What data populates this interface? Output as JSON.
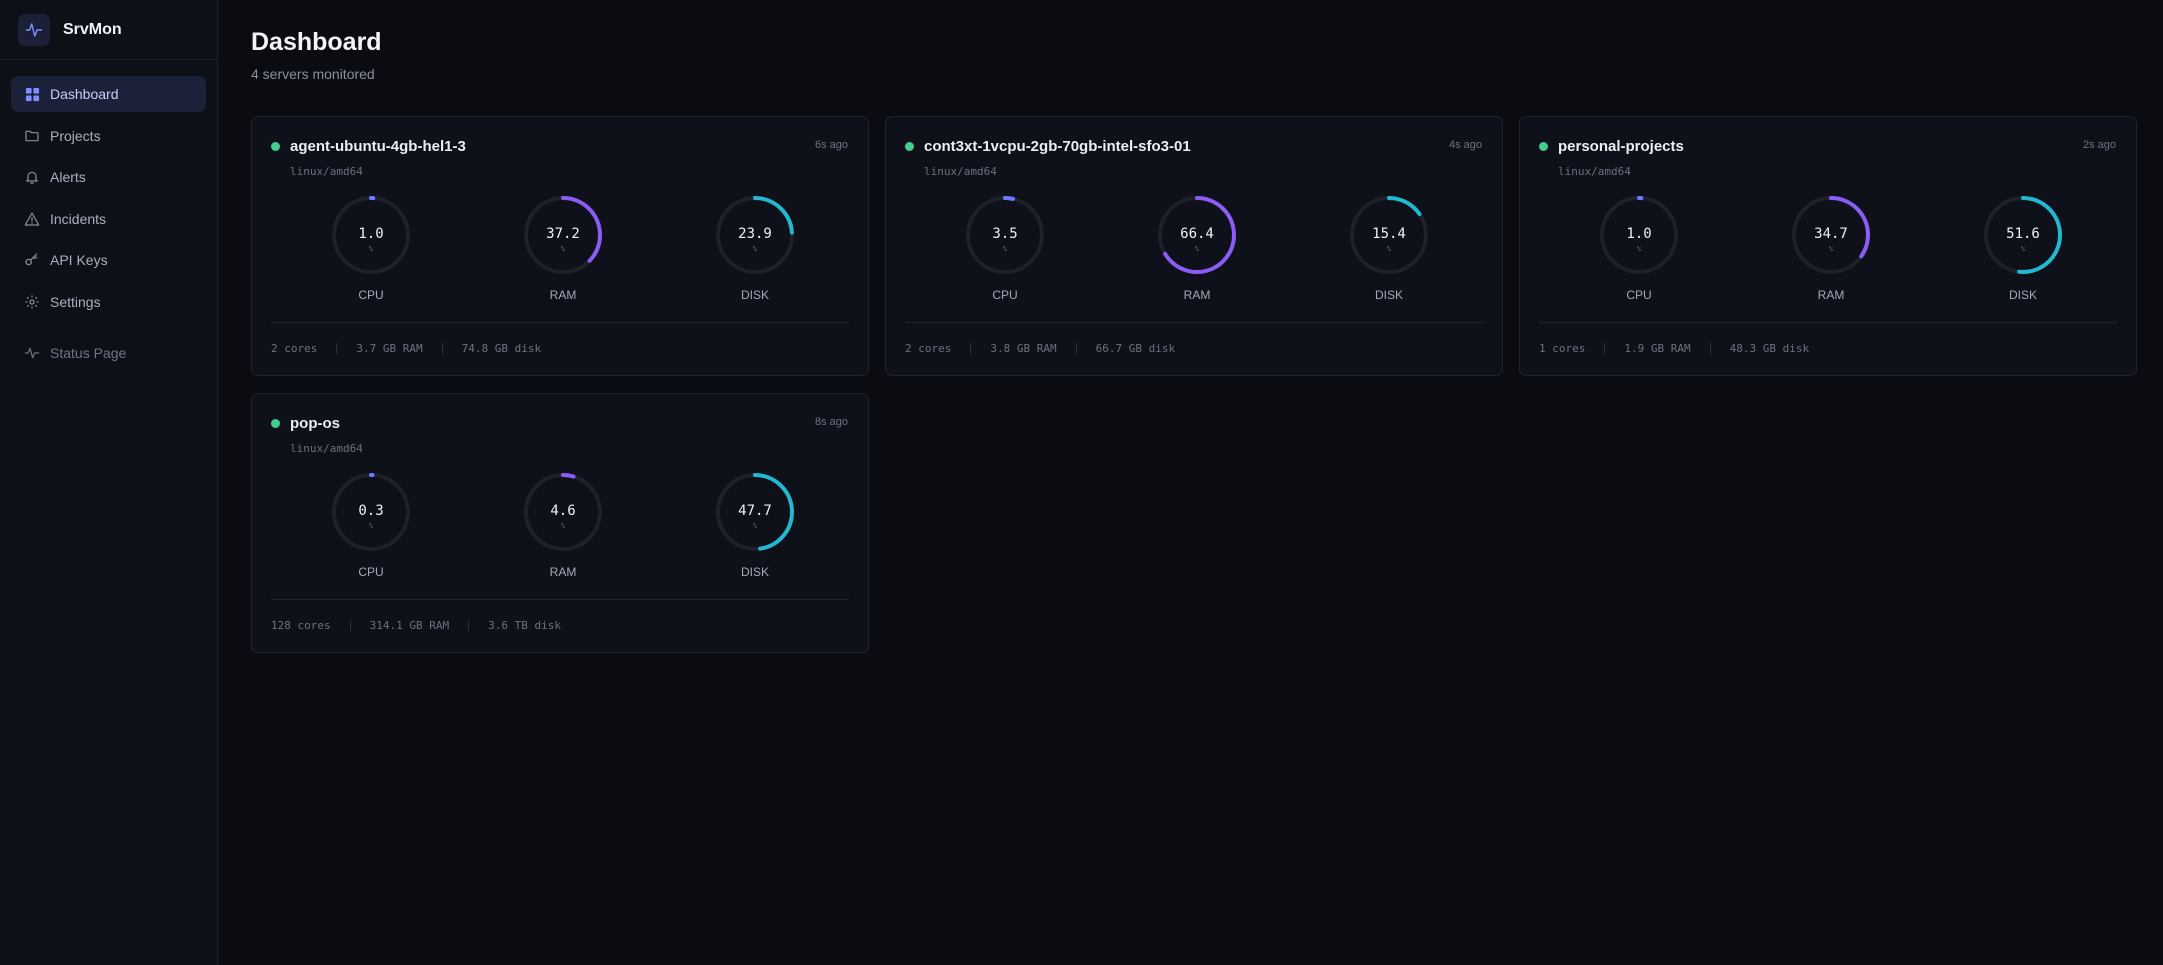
{
  "app": {
    "name": "SrvMon"
  },
  "nav": {
    "items": [
      {
        "label": "Dashboard",
        "icon": "dashboard-icon"
      },
      {
        "label": "Projects",
        "icon": "folder-icon"
      },
      {
        "label": "Alerts",
        "icon": "bell-icon"
      },
      {
        "label": "Incidents",
        "icon": "warning-icon"
      },
      {
        "label": "API Keys",
        "icon": "key-icon"
      },
      {
        "label": "Settings",
        "icon": "gear-icon"
      }
    ],
    "status_page": {
      "label": "Status Page",
      "icon": "activity-icon"
    }
  },
  "page": {
    "title": "Dashboard",
    "subtitle": "4 servers monitored"
  },
  "colors": {
    "accent": "#6b7cff",
    "cpu": "#6b7cff",
    "ram": "#8b5cf6",
    "disk": "#22b8cf",
    "online": "#3fcf8e"
  },
  "servers": [
    {
      "name": "agent-ubuntu-4gb-hel1-3",
      "ago": "6s ago",
      "arch": "linux/amd64",
      "cpu": {
        "value": "1.0",
        "unit": "%",
        "label": "CPU",
        "percent": 1.0
      },
      "ram": {
        "value": "37.2",
        "unit": "%",
        "label": "RAM",
        "percent": 37.2
      },
      "disk": {
        "value": "23.9",
        "unit": "%",
        "label": "DISK",
        "percent": 23.9
      },
      "cores": "2 cores",
      "mem": "3.7 GB RAM",
      "storage": "74.8 GB disk"
    },
    {
      "name": "cont3xt-1vcpu-2gb-70gb-intel-sfo3-01",
      "ago": "4s ago",
      "arch": "linux/amd64",
      "cpu": {
        "value": "3.5",
        "unit": "%",
        "label": "CPU",
        "percent": 3.5
      },
      "ram": {
        "value": "66.4",
        "unit": "%",
        "label": "RAM",
        "percent": 66.4
      },
      "disk": {
        "value": "15.4",
        "unit": "%",
        "label": "DISK",
        "percent": 15.4
      },
      "cores": "2 cores",
      "mem": "3.8 GB RAM",
      "storage": "66.7 GB disk"
    },
    {
      "name": "personal-projects",
      "ago": "2s ago",
      "arch": "linux/amd64",
      "cpu": {
        "value": "1.0",
        "unit": "%",
        "label": "CPU",
        "percent": 1.0
      },
      "ram": {
        "value": "34.7",
        "unit": "%",
        "label": "RAM",
        "percent": 34.7
      },
      "disk": {
        "value": "51.6",
        "unit": "%",
        "label": "DISK",
        "percent": 51.6
      },
      "cores": "1 cores",
      "mem": "1.9 GB RAM",
      "storage": "48.3 GB disk"
    },
    {
      "name": "pop-os",
      "ago": "8s ago",
      "arch": "linux/amd64",
      "cpu": {
        "value": "0.3",
        "unit": "%",
        "label": "CPU",
        "percent": 0.3
      },
      "ram": {
        "value": "4.6",
        "unit": "%",
        "label": "RAM",
        "percent": 4.6
      },
      "disk": {
        "value": "47.7",
        "unit": "%",
        "label": "DISK",
        "percent": 47.7
      },
      "cores": "128 cores",
      "mem": "314.1 GB RAM",
      "storage": "3.6 TB disk"
    }
  ]
}
